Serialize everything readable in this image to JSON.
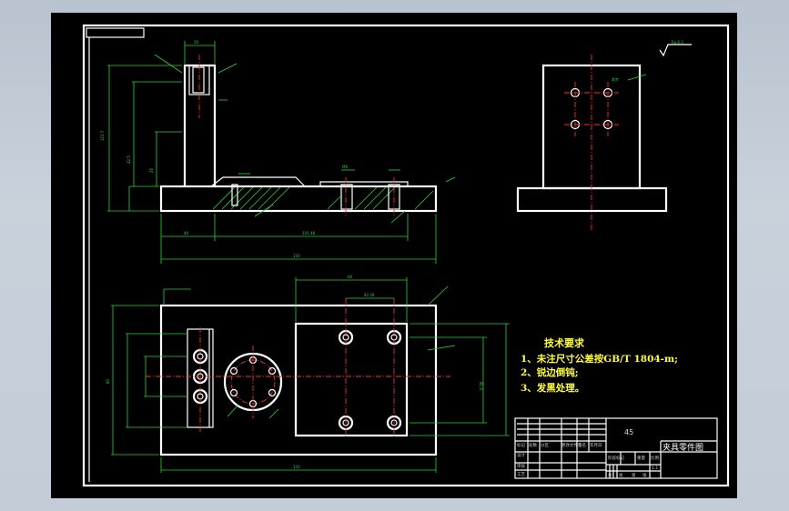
{
  "technical_requirements": {
    "title": "技术要求",
    "items": [
      "1、未注尺寸公差按GB/T 1804-m;",
      "2、锐边倒钝;",
      "3、发黑处理。"
    ]
  },
  "title_block": {
    "part_name": "夹具零件图",
    "material": "45",
    "row_labels": [
      "标记",
      "设计",
      "审核",
      "工艺"
    ],
    "columns": [
      "处数",
      "分区",
      "更改文件号",
      "签名",
      "年月日"
    ],
    "stage_labels": [
      "阶段标记",
      "重量",
      "比例"
    ],
    "scale": "1:1",
    "sheet": [
      "共",
      "张",
      "第",
      "张"
    ]
  },
  "surface_finish": {
    "symbol": "√",
    "value": "Ra 6.3"
  },
  "dimension_labels": {
    "front_top_width": "20",
    "front_height": "121.7",
    "front_mid_height": "42.5",
    "front_low_height": "26",
    "front_bottom_1": "40",
    "front_bottom_2": "101.48",
    "front_total": "150",
    "front_hole": "M6",
    "plan_total": "150",
    "plan_width": "80",
    "plan_inner": "81.6",
    "plan_top": "60",
    "plan_hole_pitch": "42.39",
    "side_note": "其余"
  },
  "colors": {
    "outline": "#ffffff",
    "dimension": "#2ed13a",
    "centerline": "#ff2a2a",
    "text": "#ffff33",
    "background": "#000000"
  }
}
